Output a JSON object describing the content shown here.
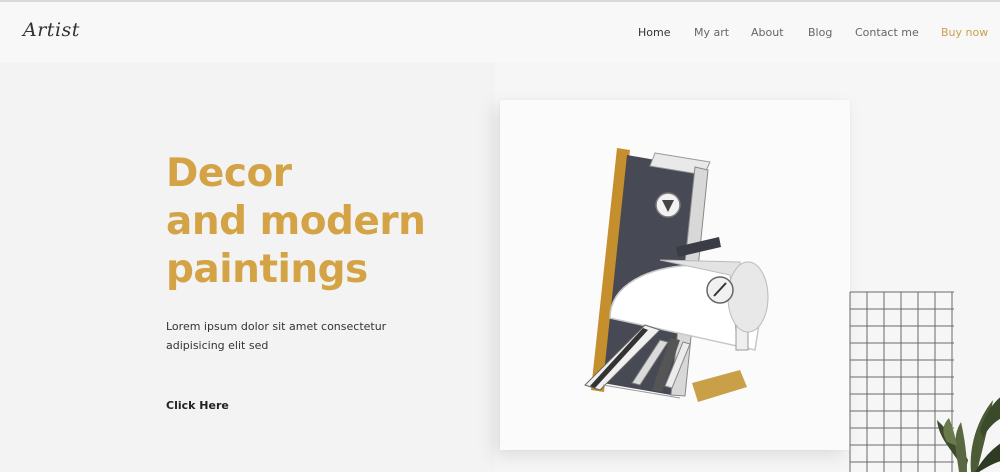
{
  "header": {
    "logo": "Artist",
    "nav": [
      {
        "label": "Home"
      },
      {
        "label": "My art"
      },
      {
        "label": "About"
      },
      {
        "label": "Blog"
      },
      {
        "label": "Contact me"
      },
      {
        "label": "Buy now"
      }
    ]
  },
  "hero": {
    "title_line1": "Decor",
    "title_line2": "and modern",
    "title_line3": "paintings",
    "subtitle_line1": "Lorem ipsum dolor sit amet consectetur",
    "subtitle_line2": "adipisicing elit sed",
    "cta": "Click Here"
  },
  "colors": {
    "accent": "#d4a345",
    "buy_now": "#c9a04e",
    "text_dark": "#333333",
    "background": "#f6f6f6"
  }
}
